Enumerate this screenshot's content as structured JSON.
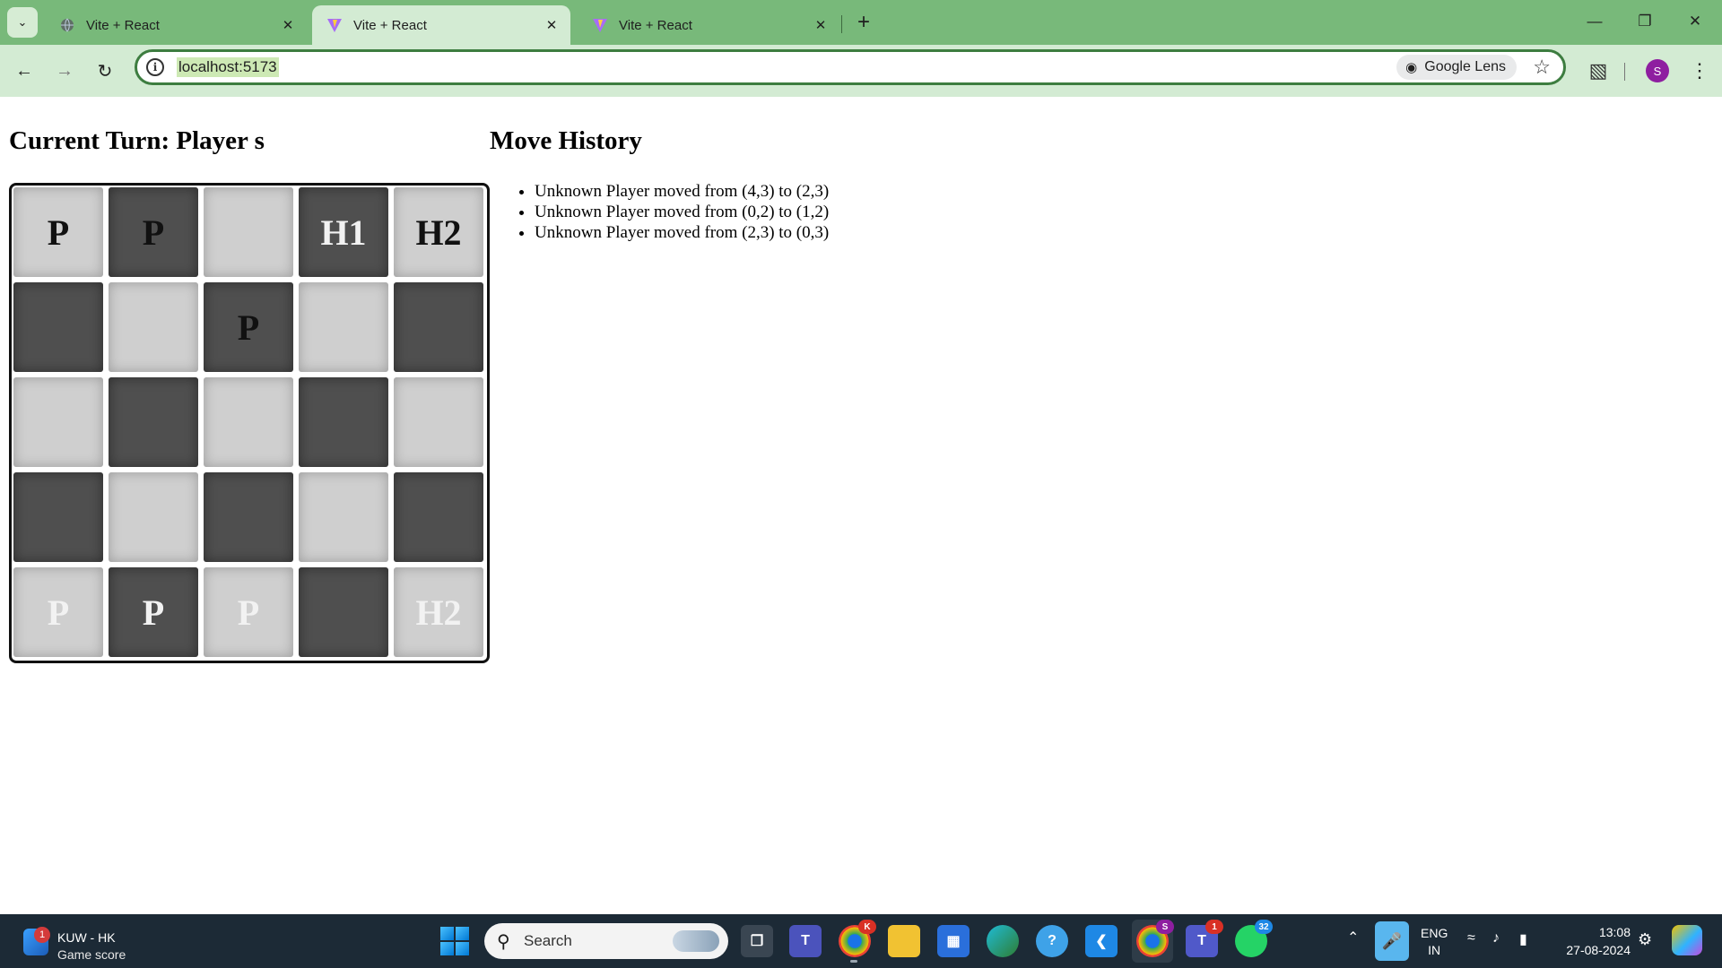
{
  "browser": {
    "tabs": [
      {
        "title": "Vite + React",
        "active": false
      },
      {
        "title": "Vite + React",
        "active": true
      },
      {
        "title": "Vite + React",
        "active": false
      }
    ],
    "url": "localhost:5173",
    "lens_label": "Google Lens",
    "profile_initial": "S",
    "accent_color": "#78b97a"
  },
  "game": {
    "turn_label": "Current Turn: Player s",
    "history_title": "Move History",
    "history": [
      "Unknown Player moved from (4,3) to (2,3)",
      "Unknown Player moved from (0,2) to (1,2)",
      "Unknown Player moved from (2,3) to (0,3)"
    ],
    "board": [
      [
        {
          "piece": "P",
          "color": "black"
        },
        {
          "piece": "P",
          "color": "black"
        },
        {
          "piece": "",
          "color": ""
        },
        {
          "piece": "H1",
          "color": "white"
        },
        {
          "piece": "H2",
          "color": "black"
        }
      ],
      [
        {
          "piece": "",
          "color": ""
        },
        {
          "piece": "",
          "color": ""
        },
        {
          "piece": "P",
          "color": "black"
        },
        {
          "piece": "",
          "color": ""
        },
        {
          "piece": "",
          "color": ""
        }
      ],
      [
        {
          "piece": "",
          "color": ""
        },
        {
          "piece": "",
          "color": ""
        },
        {
          "piece": "",
          "color": ""
        },
        {
          "piece": "",
          "color": ""
        },
        {
          "piece": "",
          "color": ""
        }
      ],
      [
        {
          "piece": "",
          "color": ""
        },
        {
          "piece": "",
          "color": ""
        },
        {
          "piece": "",
          "color": ""
        },
        {
          "piece": "",
          "color": ""
        },
        {
          "piece": "",
          "color": ""
        }
      ],
      [
        {
          "piece": "P",
          "color": "white"
        },
        {
          "piece": "P",
          "color": "white"
        },
        {
          "piece": "P",
          "color": "white"
        },
        {
          "piece": "",
          "color": ""
        },
        {
          "piece": "H2",
          "color": "white"
        }
      ]
    ]
  },
  "taskbar": {
    "widget_title": "KUW - HK",
    "widget_subtitle": "Game score",
    "widget_badge": "1",
    "search_placeholder": "Search",
    "chrome_badge": "K",
    "chrome_active_badge": "S",
    "teams_badge": "1",
    "whatsapp_badge": "32",
    "lang_line1": "ENG",
    "lang_line2": "IN",
    "time": "13:08",
    "date": "27-08-2024",
    "icons": [
      "task-view-icon",
      "teams-icon",
      "chrome-icon",
      "file-explorer-icon",
      "store-icon",
      "edge-icon",
      "help-icon",
      "vscode-icon",
      "chrome-active-icon",
      "teams-work-icon",
      "whatsapp-icon"
    ]
  }
}
